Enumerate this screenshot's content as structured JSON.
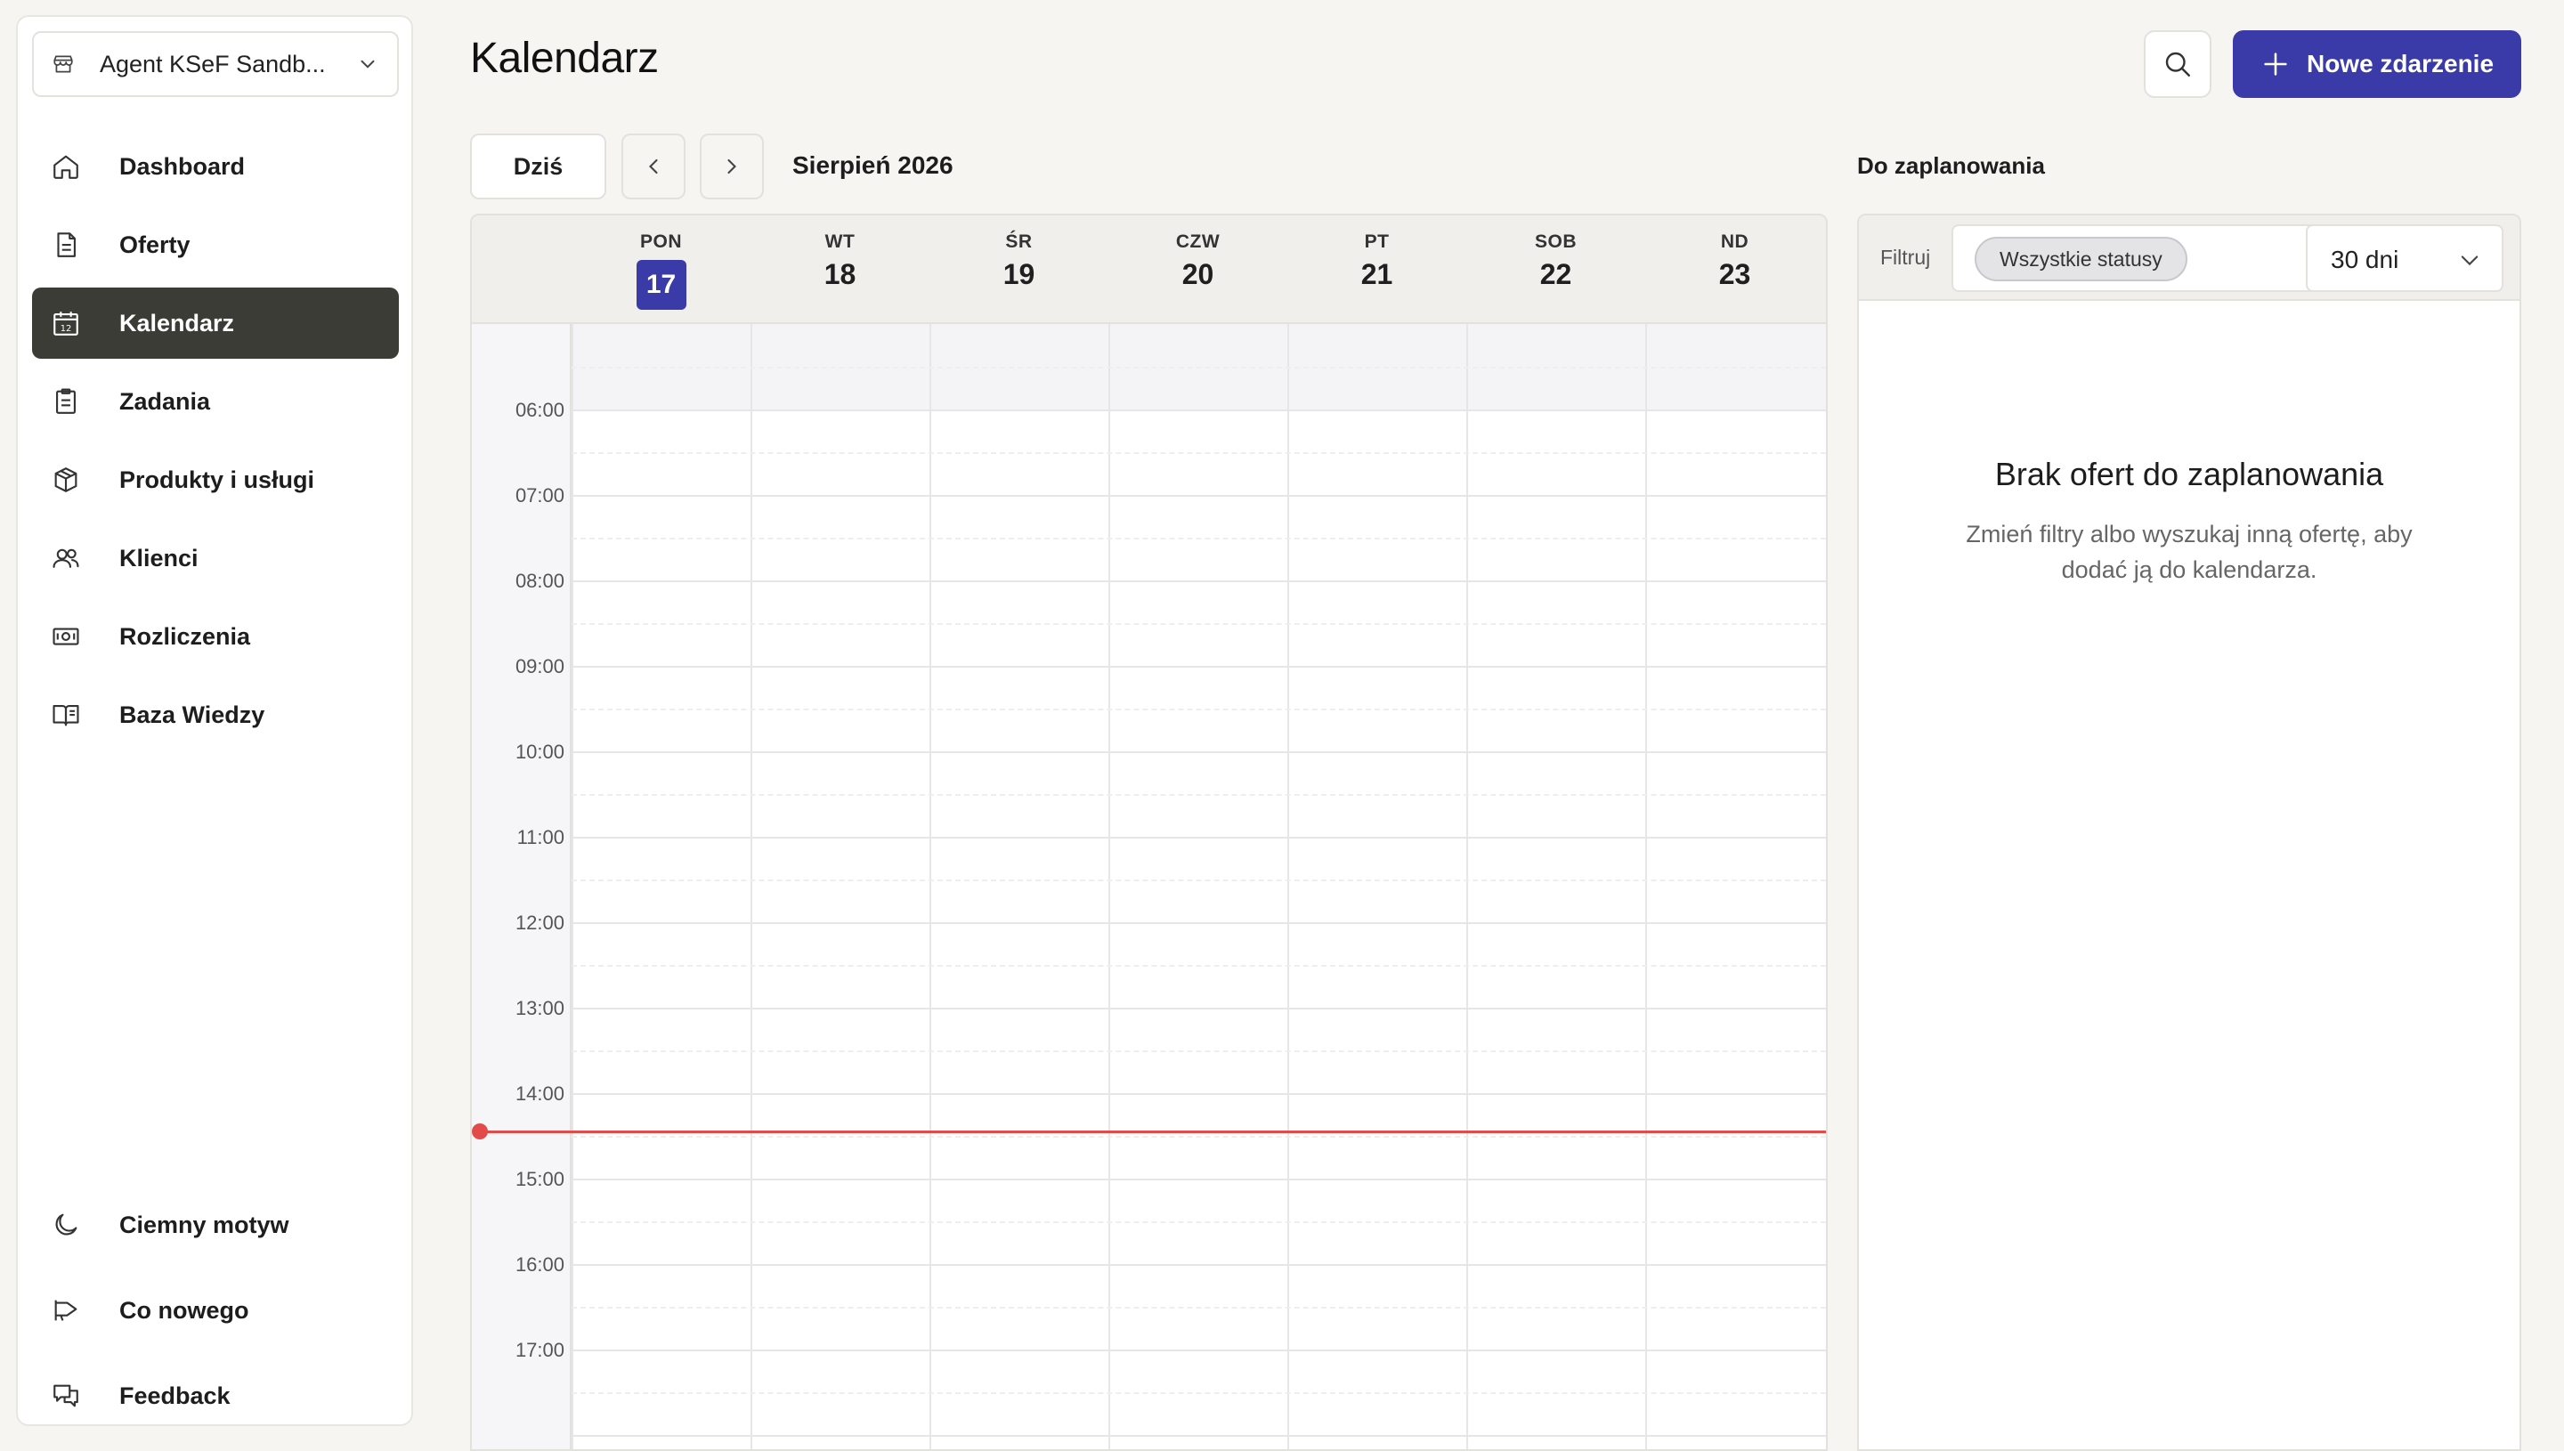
{
  "workspace": {
    "name": "Agent KSeF Sandb...",
    "icon": "store-icon"
  },
  "sidebar": {
    "items": [
      {
        "label": "Dashboard",
        "icon": "home-icon"
      },
      {
        "label": "Oferty",
        "icon": "document-icon"
      },
      {
        "label": "Kalendarz",
        "icon": "calendar-icon",
        "active": true
      },
      {
        "label": "Zadania",
        "icon": "clipboard-icon"
      },
      {
        "label": "Produkty i usługi",
        "icon": "package-icon"
      },
      {
        "label": "Klienci",
        "icon": "users-icon"
      },
      {
        "label": "Rozliczenia",
        "icon": "banknote-icon"
      },
      {
        "label": "Baza Wiedzy",
        "icon": "book-icon"
      }
    ],
    "bottom_items": [
      {
        "label": "Ciemny motyw",
        "icon": "moon-icon"
      },
      {
        "label": "Co nowego",
        "icon": "megaphone-icon"
      },
      {
        "label": "Feedback",
        "icon": "chat-icon"
      }
    ],
    "calendar_icon_day": "12"
  },
  "header": {
    "title": "Kalendarz",
    "new_event_label": "Nowe zdarzenie"
  },
  "toolbar": {
    "today_label": "Dziś",
    "month_label": "Sierpień 2026"
  },
  "calendar": {
    "days": [
      {
        "name": "PON",
        "num": "17",
        "today": true
      },
      {
        "name": "WT",
        "num": "18"
      },
      {
        "name": "ŚR",
        "num": "19"
      },
      {
        "name": "CZW",
        "num": "20"
      },
      {
        "name": "PT",
        "num": "21"
      },
      {
        "name": "SOB",
        "num": "22"
      },
      {
        "name": "ND",
        "num": "23"
      }
    ],
    "hours": [
      "06:00",
      "07:00",
      "08:00",
      "09:00",
      "10:00",
      "11:00",
      "12:00",
      "13:00",
      "14:00",
      "15:00",
      "16:00",
      "17:00"
    ],
    "current_time_indicator_color": "#e34a4a"
  },
  "unscheduled": {
    "title": "Do zaplanowania",
    "filter_label": "Filtruj",
    "status_value": "Wszystkie statusy",
    "days_value": "30 dni",
    "empty_title": "Brak ofert do zaplanowania",
    "empty_description": "Zmień filtry albo wyszukaj inną ofertę, aby dodać ją do kalendarza."
  },
  "colors": {
    "accent": "#3a3aa8",
    "sidebar_active": "#3c3c37",
    "background": "#f6f5f2"
  }
}
